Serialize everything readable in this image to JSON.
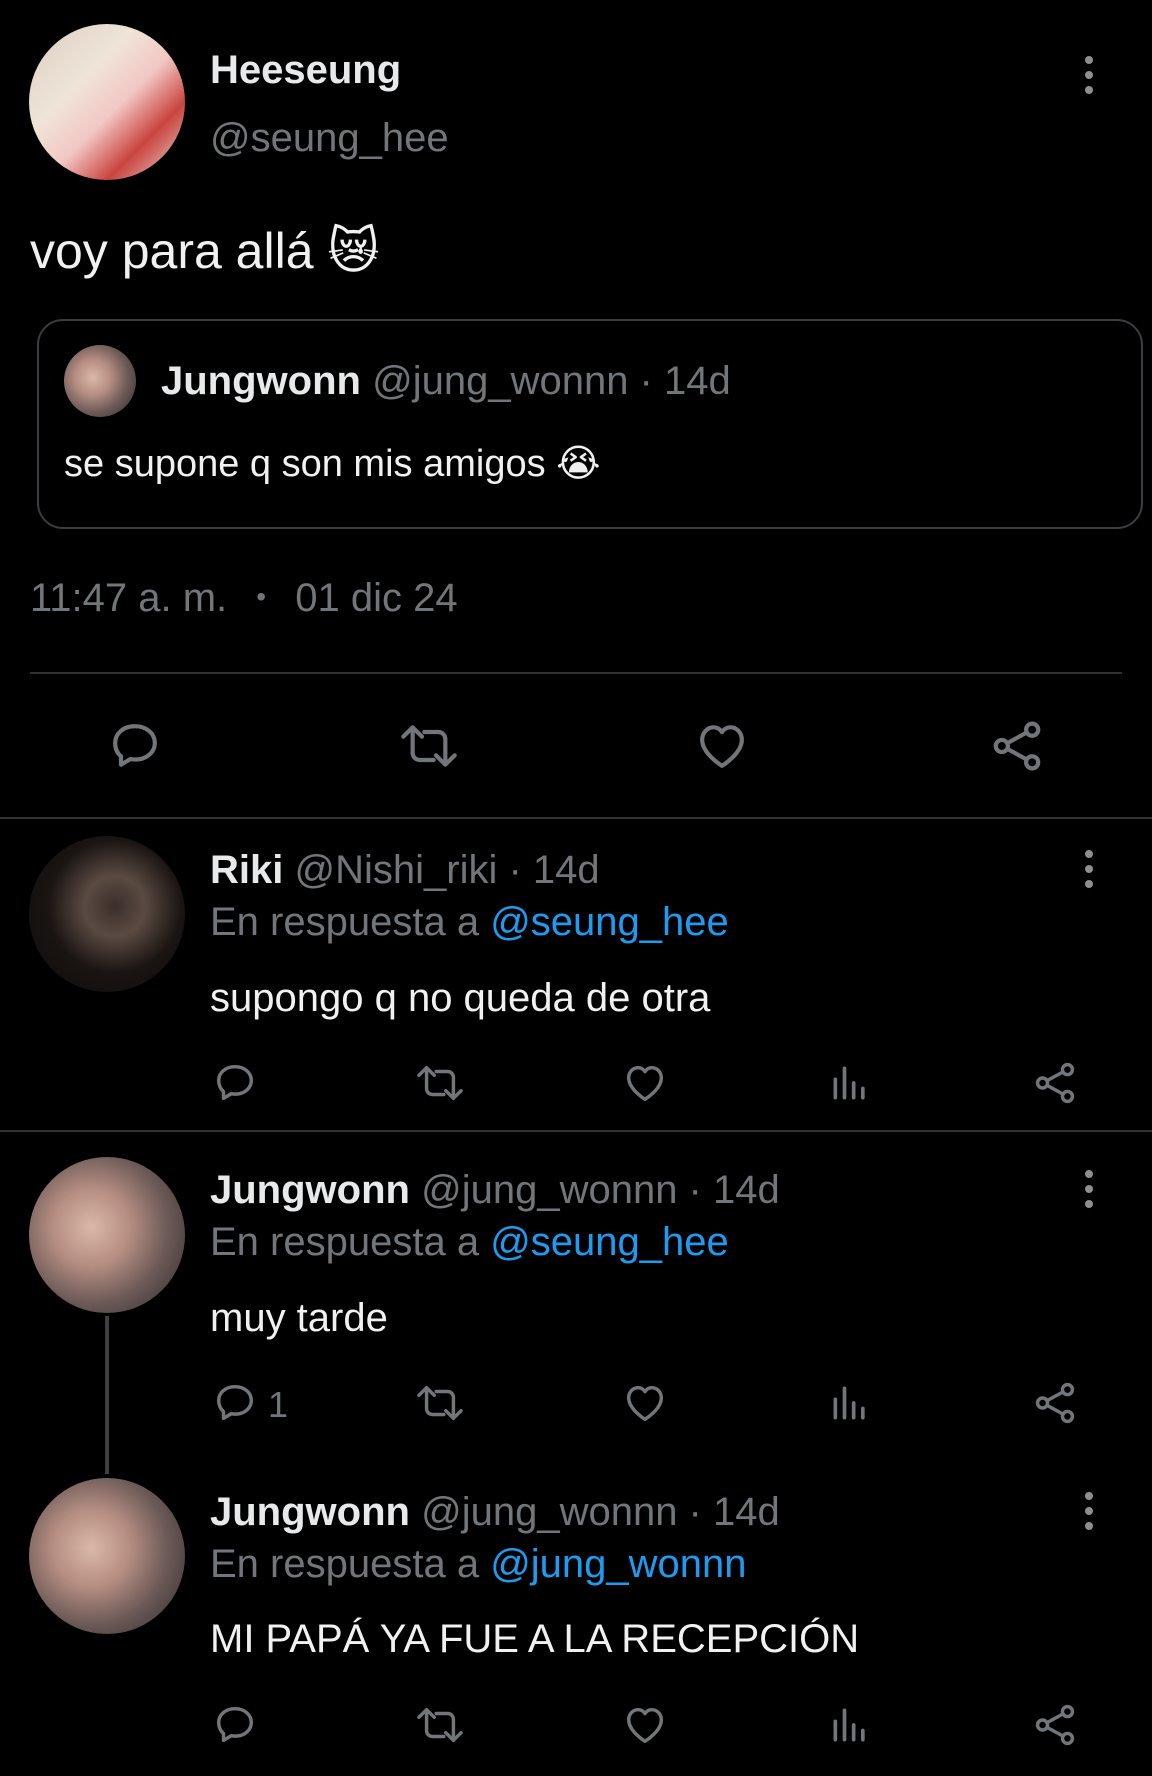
{
  "main_tweet": {
    "author_name": "Heeseung",
    "author_handle": "@seung_hee",
    "text": "voy para allá 😿",
    "quoted": {
      "author_name": "Jungwonn",
      "meta": "@jung_wonnn · 14d",
      "text": "se supone q son mis amigos 😭"
    },
    "time": "11:47 a. m.",
    "dot": "•",
    "date": "01 dic 24",
    "actions": [
      "reply-icon",
      "retweet-icon",
      "like-icon",
      "share-icon"
    ]
  },
  "replies": [
    {
      "author_name": "Riki",
      "meta": "@Nishi_riki · 14d",
      "reply_prefix": "En respuesta a",
      "reply_to": "@seung_hee",
      "text": "supongo q no queda de otra",
      "reply_count": ""
    },
    {
      "author_name": "Jungwonn",
      "meta": "@jung_wonnn · 14d",
      "reply_prefix": "En respuesta a",
      "reply_to": "@seung_hee",
      "text": "muy tarde",
      "reply_count": "1"
    },
    {
      "author_name": "Jungwonn",
      "meta": "@jung_wonnn · 14d",
      "reply_prefix": "En respuesta a",
      "reply_to": "@jung_wonnn",
      "text": "MI PAPÁ YA FUE A LA RECEPCIÓN",
      "reply_count": ""
    }
  ],
  "colors": {
    "background": "#000000",
    "text": "#e7e9ea",
    "muted": "#71767b",
    "link": "#1d9bf0",
    "divider": "#2f3336"
  }
}
